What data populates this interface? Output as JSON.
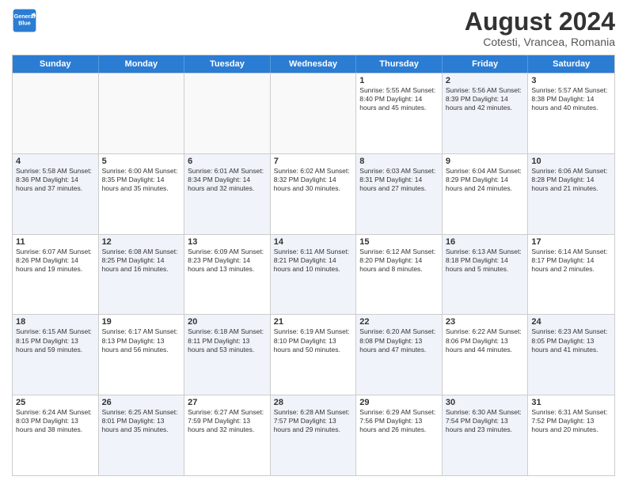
{
  "logo": {
    "line1": "General",
    "line2": "Blue"
  },
  "title": "August 2024",
  "subtitle": "Cotesti, Vrancea, Romania",
  "days": [
    "Sunday",
    "Monday",
    "Tuesday",
    "Wednesday",
    "Thursday",
    "Friday",
    "Saturday"
  ],
  "rows": [
    [
      {
        "day": "",
        "text": "",
        "empty": true
      },
      {
        "day": "",
        "text": "",
        "empty": true
      },
      {
        "day": "",
        "text": "",
        "empty": true
      },
      {
        "day": "",
        "text": "",
        "empty": true
      },
      {
        "day": "1",
        "text": "Sunrise: 5:55 AM\nSunset: 8:40 PM\nDaylight: 14 hours\nand 45 minutes.",
        "shaded": false
      },
      {
        "day": "2",
        "text": "Sunrise: 5:56 AM\nSunset: 8:39 PM\nDaylight: 14 hours\nand 42 minutes.",
        "shaded": true
      },
      {
        "day": "3",
        "text": "Sunrise: 5:57 AM\nSunset: 8:38 PM\nDaylight: 14 hours\nand 40 minutes.",
        "shaded": false
      }
    ],
    [
      {
        "day": "4",
        "text": "Sunrise: 5:58 AM\nSunset: 8:36 PM\nDaylight: 14 hours\nand 37 minutes.",
        "shaded": true
      },
      {
        "day": "5",
        "text": "Sunrise: 6:00 AM\nSunset: 8:35 PM\nDaylight: 14 hours\nand 35 minutes.",
        "shaded": false
      },
      {
        "day": "6",
        "text": "Sunrise: 6:01 AM\nSunset: 8:34 PM\nDaylight: 14 hours\nand 32 minutes.",
        "shaded": true
      },
      {
        "day": "7",
        "text": "Sunrise: 6:02 AM\nSunset: 8:32 PM\nDaylight: 14 hours\nand 30 minutes.",
        "shaded": false
      },
      {
        "day": "8",
        "text": "Sunrise: 6:03 AM\nSunset: 8:31 PM\nDaylight: 14 hours\nand 27 minutes.",
        "shaded": true
      },
      {
        "day": "9",
        "text": "Sunrise: 6:04 AM\nSunset: 8:29 PM\nDaylight: 14 hours\nand 24 minutes.",
        "shaded": false
      },
      {
        "day": "10",
        "text": "Sunrise: 6:06 AM\nSunset: 8:28 PM\nDaylight: 14 hours\nand 21 minutes.",
        "shaded": true
      }
    ],
    [
      {
        "day": "11",
        "text": "Sunrise: 6:07 AM\nSunset: 8:26 PM\nDaylight: 14 hours\nand 19 minutes.",
        "shaded": false
      },
      {
        "day": "12",
        "text": "Sunrise: 6:08 AM\nSunset: 8:25 PM\nDaylight: 14 hours\nand 16 minutes.",
        "shaded": true
      },
      {
        "day": "13",
        "text": "Sunrise: 6:09 AM\nSunset: 8:23 PM\nDaylight: 14 hours\nand 13 minutes.",
        "shaded": false
      },
      {
        "day": "14",
        "text": "Sunrise: 6:11 AM\nSunset: 8:21 PM\nDaylight: 14 hours\nand 10 minutes.",
        "shaded": true
      },
      {
        "day": "15",
        "text": "Sunrise: 6:12 AM\nSunset: 8:20 PM\nDaylight: 14 hours\nand 8 minutes.",
        "shaded": false
      },
      {
        "day": "16",
        "text": "Sunrise: 6:13 AM\nSunset: 8:18 PM\nDaylight: 14 hours\nand 5 minutes.",
        "shaded": true
      },
      {
        "day": "17",
        "text": "Sunrise: 6:14 AM\nSunset: 8:17 PM\nDaylight: 14 hours\nand 2 minutes.",
        "shaded": false
      }
    ],
    [
      {
        "day": "18",
        "text": "Sunrise: 6:15 AM\nSunset: 8:15 PM\nDaylight: 13 hours\nand 59 minutes.",
        "shaded": true
      },
      {
        "day": "19",
        "text": "Sunrise: 6:17 AM\nSunset: 8:13 PM\nDaylight: 13 hours\nand 56 minutes.",
        "shaded": false
      },
      {
        "day": "20",
        "text": "Sunrise: 6:18 AM\nSunset: 8:11 PM\nDaylight: 13 hours\nand 53 minutes.",
        "shaded": true
      },
      {
        "day": "21",
        "text": "Sunrise: 6:19 AM\nSunset: 8:10 PM\nDaylight: 13 hours\nand 50 minutes.",
        "shaded": false
      },
      {
        "day": "22",
        "text": "Sunrise: 6:20 AM\nSunset: 8:08 PM\nDaylight: 13 hours\nand 47 minutes.",
        "shaded": true
      },
      {
        "day": "23",
        "text": "Sunrise: 6:22 AM\nSunset: 8:06 PM\nDaylight: 13 hours\nand 44 minutes.",
        "shaded": false
      },
      {
        "day": "24",
        "text": "Sunrise: 6:23 AM\nSunset: 8:05 PM\nDaylight: 13 hours\nand 41 minutes.",
        "shaded": true
      }
    ],
    [
      {
        "day": "25",
        "text": "Sunrise: 6:24 AM\nSunset: 8:03 PM\nDaylight: 13 hours\nand 38 minutes.",
        "shaded": false
      },
      {
        "day": "26",
        "text": "Sunrise: 6:25 AM\nSunset: 8:01 PM\nDaylight: 13 hours\nand 35 minutes.",
        "shaded": true
      },
      {
        "day": "27",
        "text": "Sunrise: 6:27 AM\nSunset: 7:59 PM\nDaylight: 13 hours\nand 32 minutes.",
        "shaded": false
      },
      {
        "day": "28",
        "text": "Sunrise: 6:28 AM\nSunset: 7:57 PM\nDaylight: 13 hours\nand 29 minutes.",
        "shaded": true
      },
      {
        "day": "29",
        "text": "Sunrise: 6:29 AM\nSunset: 7:56 PM\nDaylight: 13 hours\nand 26 minutes.",
        "shaded": false
      },
      {
        "day": "30",
        "text": "Sunrise: 6:30 AM\nSunset: 7:54 PM\nDaylight: 13 hours\nand 23 minutes.",
        "shaded": true
      },
      {
        "day": "31",
        "text": "Sunrise: 6:31 AM\nSunset: 7:52 PM\nDaylight: 13 hours\nand 20 minutes.",
        "shaded": false
      }
    ]
  ]
}
